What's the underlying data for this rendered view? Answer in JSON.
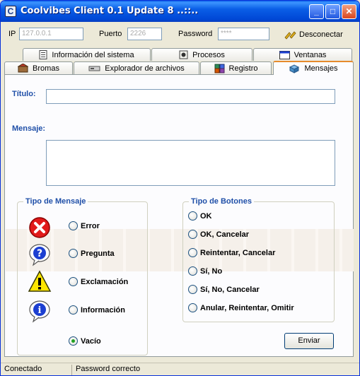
{
  "window": {
    "title": "Coolvibes Client 0.1 Update 8 ..::..",
    "app_icon_letter": "C",
    "minimize_glyph": "_",
    "maximize_glyph": "□",
    "close_glyph": "✕"
  },
  "connection": {
    "ip_label": "IP",
    "ip_value": "127.0.0.1",
    "port_label": "Puerto",
    "port_value": "2226",
    "password_label": "Password",
    "password_value": "****",
    "disconnect_label": "Desconectar"
  },
  "tabs_row1": [
    {
      "label": "Información del sistema",
      "icon": "system-info-icon"
    },
    {
      "label": "Procesos",
      "icon": "processes-icon"
    },
    {
      "label": "Ventanas",
      "icon": "windows-icon"
    }
  ],
  "tabs_row2": [
    {
      "label": "Bromas",
      "icon": "pranks-icon"
    },
    {
      "label": "Explorador de archivos",
      "icon": "file-explorer-icon"
    },
    {
      "label": "Registro",
      "icon": "registry-icon"
    },
    {
      "label": "Mensajes",
      "icon": "messages-icon",
      "active": true
    }
  ],
  "form": {
    "title_label": "Título:",
    "title_value": "",
    "message_label": "Mensaje:",
    "message_value": ""
  },
  "message_type": {
    "group_title": "Tipo de Mensaje",
    "options": [
      {
        "label": "Error",
        "icon": "error-icon",
        "checked": false
      },
      {
        "label": "Pregunta",
        "icon": "question-icon",
        "checked": false
      },
      {
        "label": "Exclamación",
        "icon": "exclamation-icon",
        "checked": false
      },
      {
        "label": "Información",
        "icon": "information-icon",
        "checked": false
      },
      {
        "label": "Vacío",
        "icon": "",
        "checked": true
      }
    ]
  },
  "button_type": {
    "group_title": "Tipo de Botones",
    "options": [
      {
        "label": "OK",
        "checked": false
      },
      {
        "label": "OK, Cancelar",
        "checked": false
      },
      {
        "label": "Reintentar, Cancelar",
        "checked": false
      },
      {
        "label": "Sí, No",
        "checked": false
      },
      {
        "label": "Sí, No, Cancelar",
        "checked": false
      },
      {
        "label": "Anular, Reintentar, Omitir",
        "checked": false
      }
    ]
  },
  "send_button_label": "Enviar",
  "status": {
    "connection_text": "Conectado",
    "password_text": "Password correcto"
  },
  "colors": {
    "title_bar": "#0a5ee6",
    "label_blue": "#1f4fa8",
    "active_tab_accent": "#e68b2c",
    "error_red": "#e11b1b",
    "info_blue": "#1c3fd1"
  }
}
